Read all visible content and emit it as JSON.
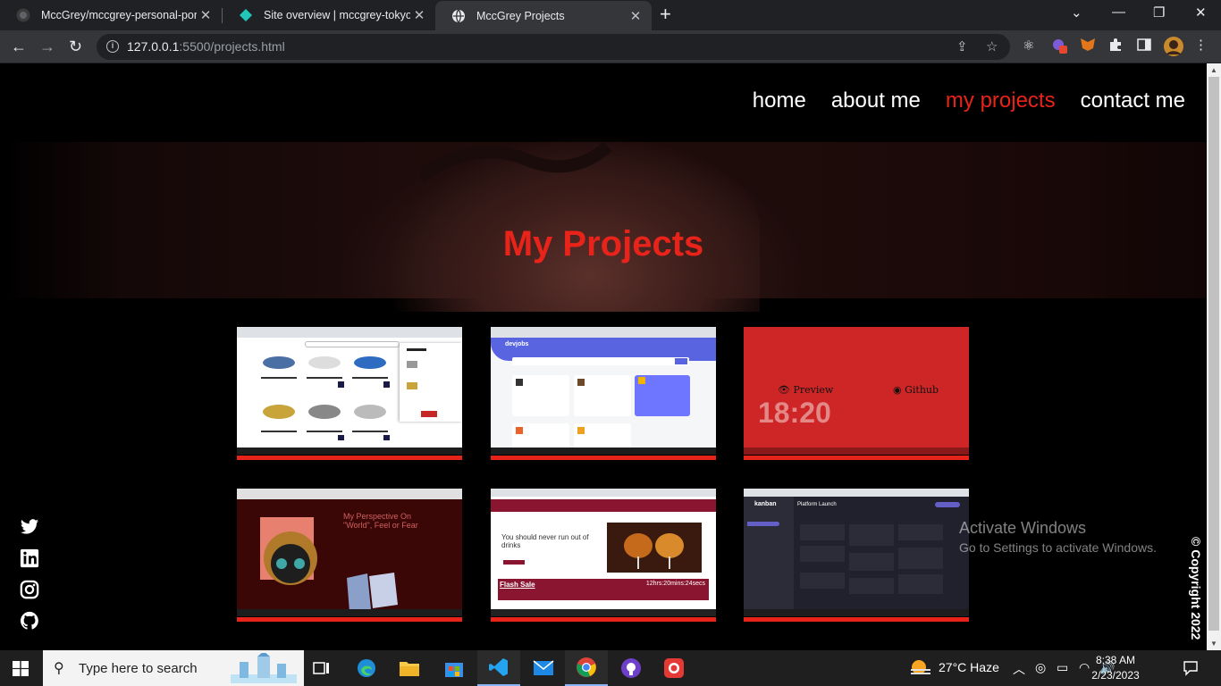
{
  "browser": {
    "tabs": [
      {
        "title": "MccGrey/mccgrey-personal-portfolio",
        "icon": "github-icon",
        "active": false
      },
      {
        "title": "Site overview | mccgrey-tokyo",
        "icon": "netlify-icon",
        "active": false
      },
      {
        "title": "MccGrey Projects",
        "icon": "globe-icon",
        "active": true
      }
    ],
    "new_tab": "+",
    "address": {
      "host": "127.0.0.1",
      "rest": ":5500/projects.html"
    },
    "window_controls": [
      "⌄",
      "—",
      "❐",
      "✕"
    ]
  },
  "site": {
    "nav": [
      {
        "label": "home",
        "current": false
      },
      {
        "label": "about me",
        "current": false
      },
      {
        "label": "my projects",
        "current": true
      },
      {
        "label": "contact me",
        "current": false
      }
    ],
    "hero_title": "My Projects",
    "projects": [
      {
        "id": "sneaker-store",
        "preview": false
      },
      {
        "id": "devjobs",
        "preview": false
      },
      {
        "id": "clock-app",
        "preview": true,
        "preview_label": "Preview",
        "github_label": "Github",
        "clock": "18:20"
      },
      {
        "id": "art-gallery",
        "preview": false,
        "heading": "My Perspective On \"World\", Feel or Fear"
      },
      {
        "id": "drinks-shop",
        "preview": false,
        "heading": "You should never run out of drinks",
        "banner": "Flash Sale",
        "timer": "12hrs:20mins:24secs"
      },
      {
        "id": "kanban",
        "preview": false,
        "brand": "kanban",
        "board": "Platform Launch"
      }
    ],
    "socials": [
      "twitter-icon",
      "linkedin-icon",
      "instagram-icon",
      "github-icon"
    ],
    "copyright": "© Copyright 2022",
    "accent": "#e8231a"
  },
  "watermark": {
    "line1": "Activate Windows",
    "line2": "Go to Settings to activate Windows."
  },
  "taskbar": {
    "search_placeholder": "Type here to search",
    "weather": "27°C  Haze",
    "time": "8:38 AM",
    "date": "2/23/2023"
  }
}
